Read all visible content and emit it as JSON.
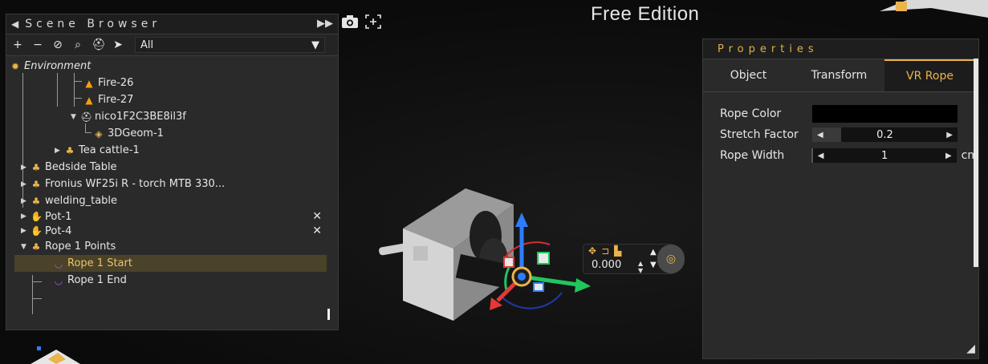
{
  "viewport": {
    "watermark": "Free Edition",
    "camera_icon": "camera-icon",
    "frame_icon": "frame-select-icon"
  },
  "scene_browser": {
    "title": "Scene Browser",
    "filter_value": "All",
    "toolbar_icons": [
      "plus-icon",
      "minus-icon",
      "link-icon",
      "search-icon",
      "hierarchy-icon",
      "pointer-icon"
    ],
    "tree": [
      {
        "label": "Environment",
        "icon": "sun-icon",
        "level": 0
      },
      {
        "label": "Fire-26",
        "icon": "fire-icon",
        "level": 3
      },
      {
        "label": "Fire-27",
        "icon": "fire-icon",
        "level": 3
      },
      {
        "label": "nico1F2C3BE8il3f",
        "icon": "group-icon",
        "level": 3,
        "expanded": true
      },
      {
        "label": "3DGeom-1",
        "icon": "geometry-icon",
        "level": 4
      },
      {
        "label": "Tea cattle-1",
        "icon": "hierarchy-icon",
        "level": 2,
        "collapsed": true
      },
      {
        "label": "Bedside Table",
        "icon": "hierarchy-icon",
        "level": 0,
        "collapsed": true
      },
      {
        "label": "Fronius WF25i R - torch MTB 330...",
        "icon": "hierarchy-icon",
        "level": 0,
        "collapsed": true
      },
      {
        "label": "welding_table",
        "icon": "hierarchy-icon",
        "level": 0,
        "collapsed": true
      },
      {
        "label": "Pot-1",
        "icon": "hand-icon",
        "level": 0,
        "collapsed": true,
        "removable": true
      },
      {
        "label": "Pot-4",
        "icon": "hand-icon",
        "level": 0,
        "collapsed": true,
        "removable": true
      },
      {
        "label": "Rope 1 Points",
        "icon": "hierarchy-icon",
        "level": 0,
        "expanded": true
      },
      {
        "label": "Rope 1 Start",
        "icon": "rope-point-icon",
        "level": 1,
        "selected": true
      },
      {
        "label": "Rope 1 End",
        "icon": "rope-point-icon",
        "level": 1
      }
    ]
  },
  "properties": {
    "title": "Properties",
    "tabs": [
      {
        "label": "Object",
        "active": false
      },
      {
        "label": "Transform",
        "active": false
      },
      {
        "label": "VR Rope",
        "active": true
      }
    ],
    "fields": {
      "rope_color": {
        "label": "Rope Color",
        "value": "#000000"
      },
      "stretch_factor": {
        "label": "Stretch Factor",
        "value": "0.2",
        "level": 0.2
      },
      "rope_width": {
        "label": "Rope Width",
        "value": "1",
        "unit": "cm",
        "level": 0.0
      }
    }
  },
  "gizmo_widget": {
    "value": "0.000"
  },
  "colors": {
    "accent": "#e9b44c",
    "panel": "#2a2a2a",
    "selected_row": "#4a4229",
    "axis_x": "#e53935",
    "axis_y": "#2e7dff",
    "axis_z": "#22c55e"
  }
}
